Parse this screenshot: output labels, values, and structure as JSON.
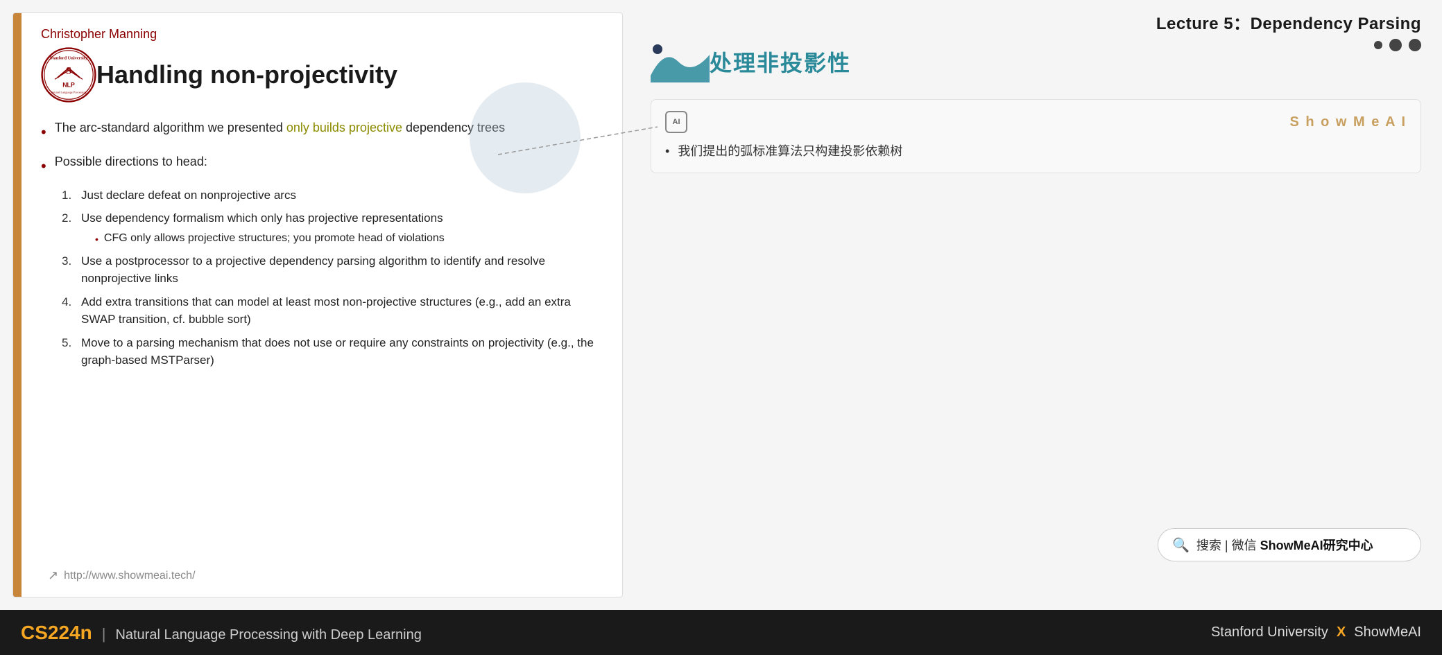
{
  "lecture": {
    "title": "Lecture 5：Dependency Parsing"
  },
  "slide": {
    "author": "Christopher Manning",
    "title": "Handling non-projectivity",
    "url": "http://www.showmeai.tech/",
    "bullet1": {
      "prefix": "The arc-standard algorithm we presented ",
      "highlight": "only builds projective",
      "suffix": " dependency trees"
    },
    "bullet2": "Possible directions to head:",
    "numbered_items": [
      "Just declare defeat on nonprojective arcs",
      "Use dependency formalism which only has projective representations",
      "Use a postprocessor to a projective dependency parsing algorithm to identify and resolve nonprojective links",
      "Add extra transitions that can model at least most non-projective structures (e.g., add an extra SWAP transition, cf. bubble sort)",
      "Move to a parsing mechanism that does not use or require any constraints on projectivity (e.g., the graph-based MSTParser)"
    ],
    "sub_bullet": "CFG only allows projective structures; you promote head of violations"
  },
  "right_panel": {
    "chinese_title": "处理非投影性",
    "ai_icon_label": "AI",
    "showmeai_label": "S h o w M e A I",
    "translation_bullet": "我们提出的弧标准算法只构建投影依赖树"
  },
  "search": {
    "icon": "🔍",
    "text": "搜索 | 微信 ",
    "bold_text": "ShowMeAI研究中心"
  },
  "bottom_bar": {
    "course_code": "CS224n",
    "separator": "|",
    "course_name": "Natural Language Processing with Deep Learning",
    "right_text": "Stanford University",
    "x_symbol": "X",
    "showmeai": "ShowMeAI"
  },
  "nav_dots": [
    "dot1",
    "dot2",
    "dot3"
  ],
  "small_dot": "dot-small"
}
